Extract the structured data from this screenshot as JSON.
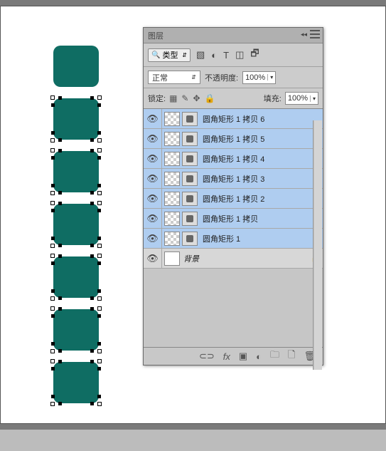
{
  "panel": {
    "title": "图层",
    "filter_label": "类型",
    "blend_mode": "正常",
    "opacity_label": "不透明度:",
    "opacity_value": "100%",
    "lock_label": "锁定:",
    "fill_label": "填充:",
    "fill_value": "100%"
  },
  "layers": [
    {
      "name": "圆角矩形 1 拷贝 6"
    },
    {
      "name": "圆角矩形 1 拷贝 5"
    },
    {
      "name": "圆角矩形 1 拷贝 4"
    },
    {
      "name": "圆角矩形 1 拷贝 3"
    },
    {
      "name": "圆角矩形 1 拷贝 2"
    },
    {
      "name": "圆角矩形 1 拷贝"
    },
    {
      "name": "圆角矩形 1"
    }
  ],
  "bg_layer": {
    "name": "背景"
  }
}
